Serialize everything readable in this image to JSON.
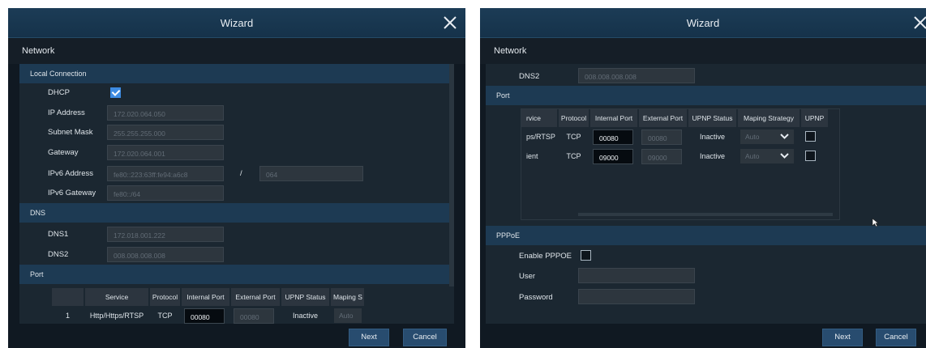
{
  "left": {
    "title": "Wizard",
    "page": "Network",
    "local_connection": "Local Connection",
    "dhcp": {
      "label": "DHCP",
      "checked": true
    },
    "ip_address": {
      "label": "IP Address",
      "value": "172.020.064.050"
    },
    "subnet_mask": {
      "label": "Subnet Mask",
      "value": "255.255.255.000"
    },
    "gateway": {
      "label": "Gateway",
      "value": "172.020.064.001"
    },
    "ipv6_address": {
      "label": "IPv6 Address",
      "value": "fe80::223:63ff:fe94:a6c8",
      "sep": "/",
      "prefix": "064"
    },
    "ipv6_gateway": {
      "label": "IPv6 Gateway",
      "value": "fe80::/64"
    },
    "dns": "DNS",
    "dns1": {
      "label": "DNS1",
      "value": "172.018.001.222"
    },
    "dns2": {
      "label": "DNS2",
      "value": "008.008.008.008"
    },
    "port": "Port",
    "table": {
      "headers": [
        "Service",
        "Protocol",
        "Internal Port",
        "External Port",
        "UPNP Status",
        "Maping S"
      ],
      "row": {
        "num": "1",
        "service": "Http/Https/RTSP",
        "protocol": "TCP",
        "internal": "00080",
        "external": "00080",
        "status": "Inactive",
        "strategy": "Auto"
      }
    },
    "next": "Next",
    "cancel": "Cancel"
  },
  "right": {
    "title": "Wizard",
    "page": "Network",
    "dns2": {
      "label": "DNS2",
      "value": "008.008.008.008"
    },
    "port": "Port",
    "table": {
      "headers": [
        "rvice",
        "Protocol",
        "Internal Port",
        "External Port",
        "UPNP Status",
        "Maping Strategy",
        "UPNP"
      ],
      "rows": [
        {
          "service": "ps/RTSP",
          "protocol": "TCP",
          "internal": "00080",
          "external": "00080",
          "status": "Inactive",
          "strategy": "Auto"
        },
        {
          "service": "ient",
          "protocol": "TCP",
          "internal": "09000",
          "external": "09000",
          "status": "Inactive",
          "strategy": "Auto"
        }
      ]
    },
    "pppoe": "PPPoE",
    "enable_pppoe": {
      "label": "Enable PPPOE",
      "checked": false
    },
    "user": {
      "label": "User",
      "value": ""
    },
    "password": {
      "label": "Password",
      "value": ""
    },
    "next": "Next",
    "cancel": "Cancel"
  },
  "icons": {
    "close": "close-icon",
    "dropdown": "chevron-down-icon",
    "checkmark": "check-icon",
    "cursor": "mouse-pointer-icon"
  },
  "colors": {
    "titlebar": "#1c3c56",
    "section_header": "#1d3a53",
    "panel_bg": "#1b2731",
    "checkbox_on": "#3d8be2",
    "button": "#284c6f"
  }
}
